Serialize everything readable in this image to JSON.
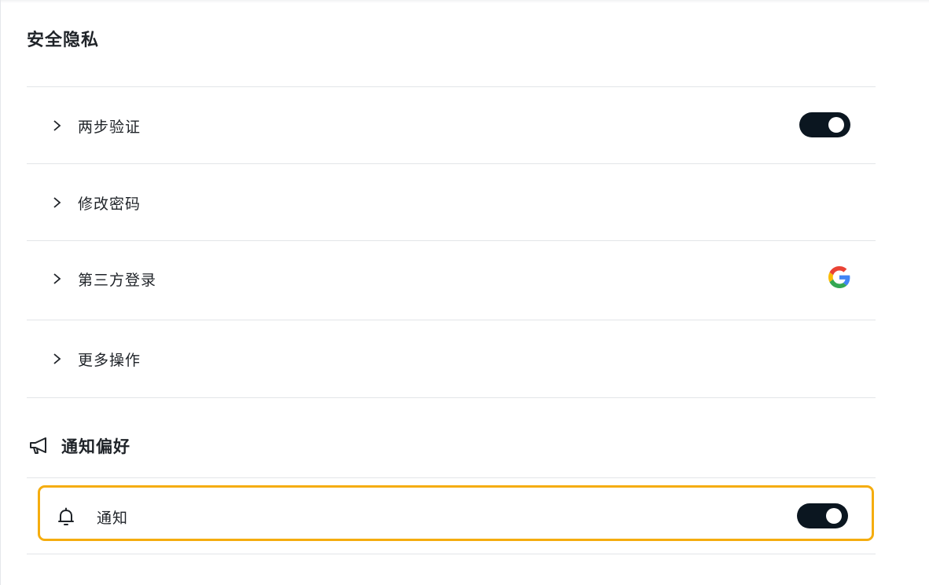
{
  "security": {
    "title": "安全隐私",
    "items": [
      {
        "label": "两步验证",
        "control": "toggle",
        "toggle_on": true
      },
      {
        "label": "修改密码",
        "control": "none"
      },
      {
        "label": "第三方登录",
        "control": "google-icon"
      },
      {
        "label": "更多操作",
        "control": "none"
      }
    ]
  },
  "notifications": {
    "title": "通知偏好",
    "title_icon": "megaphone-icon",
    "items": [
      {
        "label": "通知",
        "icon": "bell-icon",
        "control": "toggle",
        "toggle_on": true
      }
    ]
  },
  "colors": {
    "toggle_on": "#0b1620",
    "highlight_border": "#f5ad0f",
    "divider": "#e3e5e8"
  }
}
